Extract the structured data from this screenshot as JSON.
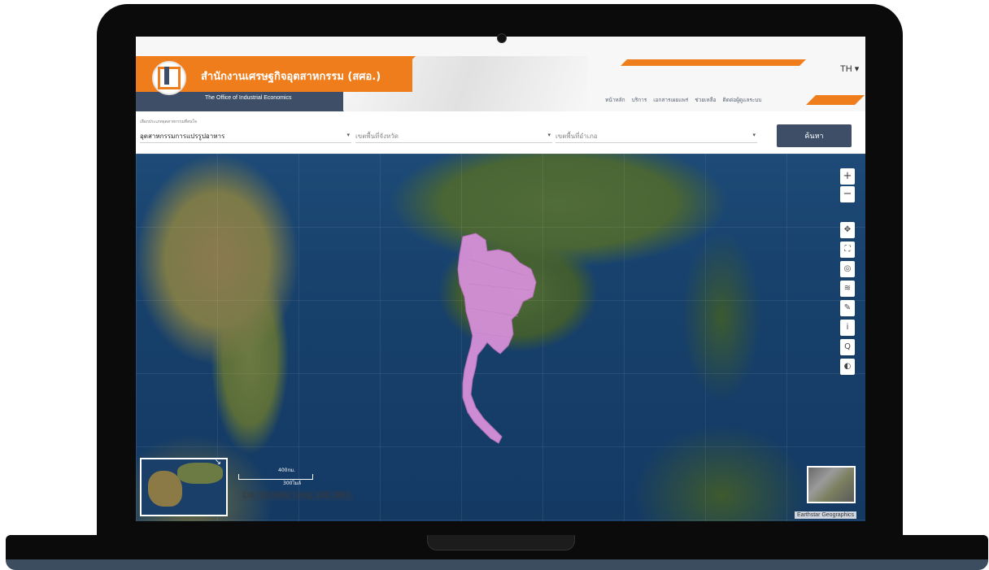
{
  "header": {
    "title_th": "สำนักงานเศรษฐกิจอุตสาหกรรม (สศอ.)",
    "title_en": "The Office of Industrial Economics",
    "nav": [
      "หน้าหลัก",
      "บริการ",
      "เอกสารเผยแพร่",
      "ช่วยเหลือ",
      "ติดต่อผู้ดูแลระบบ"
    ],
    "lang": "TH ▾",
    "brand_color": "#ef7d1b",
    "secondary_color": "#3d4e66"
  },
  "filters": {
    "industry_label": "เลือกประเภทอุตสาหกรรมที่สนใจ",
    "industry_value": "อุตสาหกรรมการแปรรูปอาหาร",
    "province_placeholder": "เขตพื้นที่จังหวัด",
    "district_placeholder": "เขตพื้นที่อำเภอ",
    "search_label": "ค้นหา",
    "caret": "▾"
  },
  "map": {
    "zoom_in": "+",
    "zoom_out": "−",
    "tools": [
      "✥",
      "⛶",
      "◎",
      "≋",
      "✎",
      "i",
      "Q",
      "◐"
    ],
    "scale_km": "400กม.",
    "scale_mi": "300ไมล์",
    "coords": "Lat: 25.5688; Long: 132.1862",
    "attribution": "Earthstar Geographics",
    "highlight_color": "#d08fd6",
    "overview_collapse": "↘"
  }
}
